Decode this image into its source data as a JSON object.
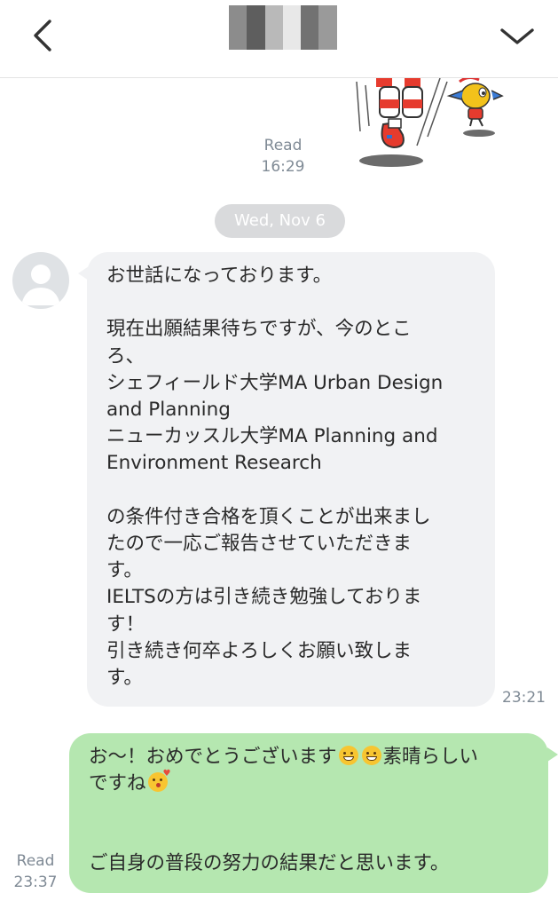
{
  "header": {
    "back_icon": "chevron-left-icon",
    "menu_icon": "chevron-down-icon",
    "contact_name": "",
    "contact_name_blur_colors": [
      "#8c8c8c",
      "#5e5e5e",
      "#b9b9b9",
      "#e8e8e8",
      "#727272",
      "#9a9a9a",
      "#ffffff"
    ]
  },
  "messages": {
    "prev_read_label": "Read",
    "prev_read_time": "16:29",
    "date_divider": "Wed, Nov 6",
    "incoming_text": "お世話になっております。\n\n現在出願結果待ちですが、今のとこ\nろ、\nシェフィールド大学MA Urban Design\nand Planning\nニューカッスル大学MA Planning and\nEnvironment Research\n\nの条件付き合格を頂くことが出来まし\nたので一応ご報告させていただきま\nす。\nIELTSの方は引き続き勉強しておりま\nす！\n引き続き何卒よろしくお願い致しま\nす。",
    "incoming_time": "23:21",
    "outgoing_line1_a": "お～！おめでとうございます",
    "outgoing_line1_b": "素晴らしい",
    "outgoing_line2": "ですね",
    "outgoing_line3": "ご自身の普段の努力の結果だと思います。",
    "outgoing_read_label": "Read",
    "outgoing_read_time": "23:37"
  },
  "icons": {
    "sticker": "cartoon-sticker-icon",
    "avatar": "default-avatar-icon",
    "emoji_grin": "grinning-face-icon",
    "emoji_kiss": "kissing-face-icon"
  },
  "colors": {
    "incoming_bubble": "#f1f2f4",
    "outgoing_bubble": "#b5e7b0",
    "date_pill": "#d9dadc",
    "meta_text": "#7f8a95"
  }
}
